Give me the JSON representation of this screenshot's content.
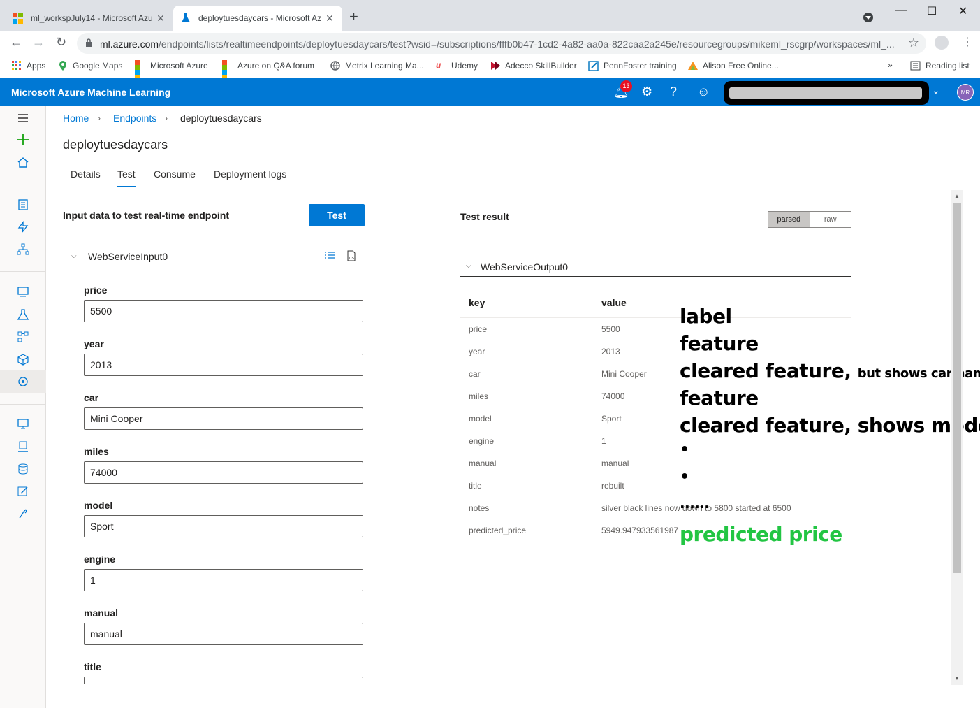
{
  "browser": {
    "tabs": [
      {
        "title": "ml_workspJuly14 - Microsoft Azu",
        "close": "✕"
      },
      {
        "title": "deploytuesdaycars - Microsoft Az",
        "close": "✕"
      }
    ],
    "new_tab": "+",
    "url_host": "ml.azure.com",
    "url_path": "/endpoints/lists/realtimeendpoints/deploytuesdaycars/test?wsid=/subscriptions/fffb0b47-1cd2-4a82-aa0a-822caa2a245e/resourcegroups/mikeml_rscgrp/workspaces/ml_...",
    "bookmarks": [
      {
        "label": "Apps"
      },
      {
        "label": "Google Maps"
      },
      {
        "label": "Microsoft Azure"
      },
      {
        "label": "Azure on Q&A forum"
      },
      {
        "label": "Metrix Learning Ma..."
      },
      {
        "label": "Udemy"
      },
      {
        "label": "Adecco SkillBuilder"
      },
      {
        "label": "PennFoster training"
      },
      {
        "label": "Alison Free Online..."
      }
    ],
    "more": "»",
    "reading_list": "Reading list"
  },
  "azure": {
    "brand": "Microsoft Azure Machine Learning",
    "notifications": "13",
    "user_initials": "MR"
  },
  "breadcrumb": {
    "home": "Home",
    "endpoints": "Endpoints",
    "current": "deploytuesdaycars"
  },
  "page": {
    "title": "deploytuesdaycars",
    "tabs": [
      "Details",
      "Test",
      "Consume",
      "Deployment logs"
    ],
    "active_tab": "Test"
  },
  "input": {
    "heading": "Input data to test real-time endpoint",
    "test_button": "Test",
    "group": "WebServiceInput0",
    "fields": [
      {
        "label": "price",
        "value": "5500"
      },
      {
        "label": "year",
        "value": "2013"
      },
      {
        "label": "car",
        "value": "Mini Cooper"
      },
      {
        "label": "miles",
        "value": "74000"
      },
      {
        "label": "model",
        "value": "Sport"
      },
      {
        "label": "engine",
        "value": "1"
      },
      {
        "label": "manual",
        "value": "manual"
      },
      {
        "label": "title",
        "value": ""
      }
    ]
  },
  "result": {
    "heading": "Test result",
    "toggle": {
      "parsed": "parsed",
      "raw": "raw",
      "selected": "parsed"
    },
    "group": "WebServiceOutput0",
    "col_key": "key",
    "col_value": "value",
    "rows": [
      {
        "key": "price",
        "value": "5500"
      },
      {
        "key": "year",
        "value": "2013"
      },
      {
        "key": "car",
        "value": "Mini Cooper"
      },
      {
        "key": "miles",
        "value": "74000"
      },
      {
        "key": "model",
        "value": "Sport"
      },
      {
        "key": "engine",
        "value": "1"
      },
      {
        "key": "manual",
        "value": "manual"
      },
      {
        "key": "title",
        "value": "rebuilt"
      },
      {
        "key": "notes",
        "value": "silver black lines now down to 5800 started at 6500"
      },
      {
        "key": "predicted_price",
        "value": "5949.947933561987"
      }
    ]
  },
  "annotations": {
    "a1": "label",
    "a2": "feature",
    "a3": "cleared feature,",
    "a3_small": "but shows car name",
    "a4": "feature",
    "a5": "cleared feature, shows model",
    "a6": "•",
    "a7": "•",
    "a8": "......",
    "a9": "predicted price"
  },
  "colors": {
    "azure_blue": "#0078d4",
    "annotation_green": "#22c543",
    "badge_red": "#e81123"
  }
}
